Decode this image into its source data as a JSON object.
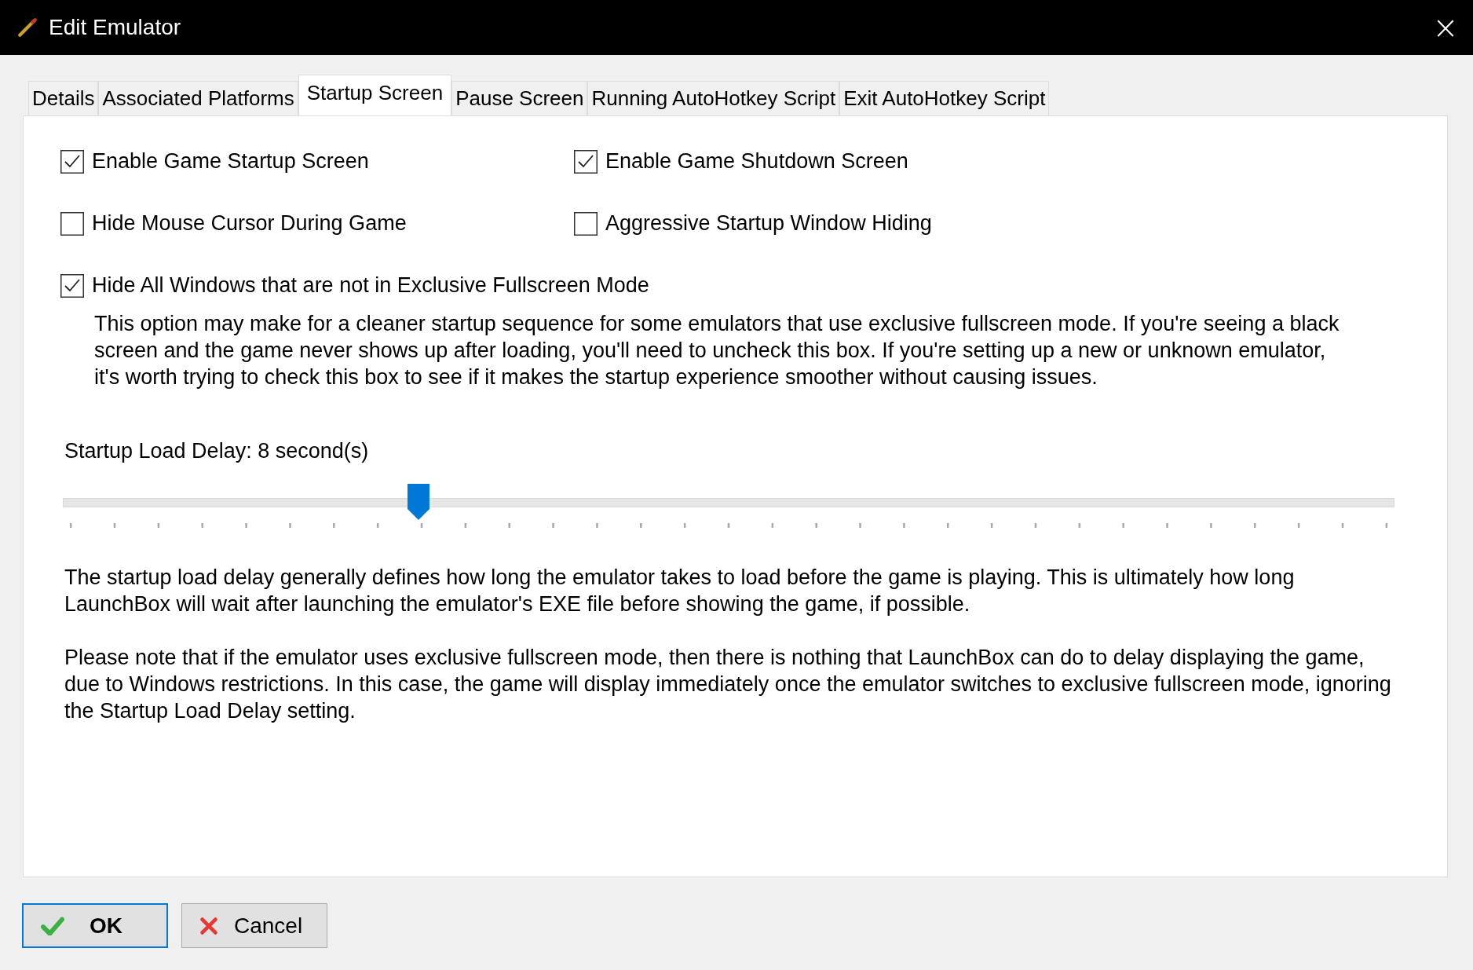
{
  "window": {
    "title": "Edit Emulator",
    "close": "×"
  },
  "tabs": [
    {
      "label": "Details",
      "selected": false
    },
    {
      "label": "Associated Platforms",
      "selected": false
    },
    {
      "label": "Startup Screen",
      "selected": true
    },
    {
      "label": "Pause Screen",
      "selected": false
    },
    {
      "label": "Running AutoHotkey Script",
      "selected": false
    },
    {
      "label": "Exit AutoHotkey Script",
      "selected": false
    }
  ],
  "options": [
    {
      "label": "Enable Game Startup Screen",
      "checked": true
    },
    {
      "label": "Enable Game Shutdown Screen",
      "checked": true
    },
    {
      "label": "Hide Mouse Cursor During Game",
      "checked": false
    },
    {
      "label": "Aggressive Startup Window Hiding",
      "checked": false
    }
  ],
  "exclusive_option": {
    "label": "Hide All Windows that are not in Exclusive Fullscreen Mode",
    "checked": true,
    "description": "This option may make for a cleaner startup sequence for some emulators that use exclusive fullscreen mode. If you're seeing a black screen and the game never shows up after loading, you'll need to uncheck this box. If you're setting up a new or unknown emulator, it's worth trying to check this box to see if it makes the startup experience smoother without causing issues."
  },
  "delay": {
    "label": "Startup Load Delay: 8 second(s)",
    "level": 0.267
  },
  "notes": [
    "The startup load delay generally defines how long the emulator takes to load before the game is playing. This is ultimately how long LaunchBox will wait after launching the emulator's EXE file before showing the game, if possible.",
    "Please note that if the emulator uses exclusive fullscreen mode, then there is nothing that LaunchBox can do to delay displaying the game, due to Windows restrictions. In this case, the game will display immediately once the emulator switches to exclusive fullscreen mode, ignoring the Startup Load Delay setting."
  ],
  "buttons": [
    {
      "label": "OK",
      "kind": "ok"
    },
    {
      "label": "Cancel",
      "kind": "cancel"
    }
  ]
}
